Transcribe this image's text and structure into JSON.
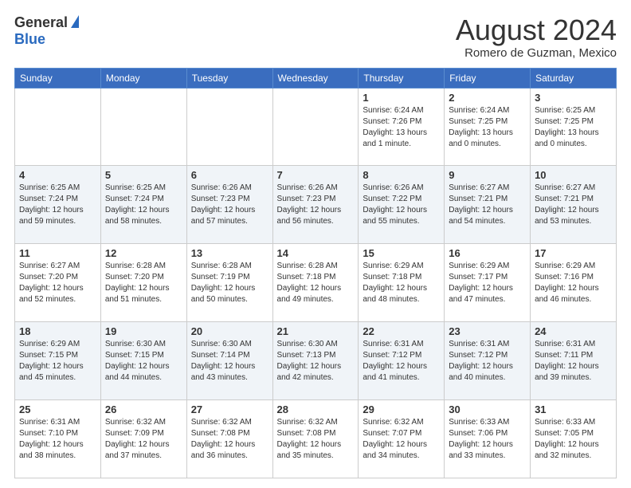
{
  "header": {
    "logo_general": "General",
    "logo_blue": "Blue",
    "month_title": "August 2024",
    "location": "Romero de Guzman, Mexico"
  },
  "days_of_week": [
    "Sunday",
    "Monday",
    "Tuesday",
    "Wednesday",
    "Thursday",
    "Friday",
    "Saturday"
  ],
  "weeks": [
    {
      "shade": false,
      "days": [
        {
          "num": "",
          "info": ""
        },
        {
          "num": "",
          "info": ""
        },
        {
          "num": "",
          "info": ""
        },
        {
          "num": "",
          "info": ""
        },
        {
          "num": "1",
          "info": "Sunrise: 6:24 AM\nSunset: 7:26 PM\nDaylight: 13 hours\nand 1 minute."
        },
        {
          "num": "2",
          "info": "Sunrise: 6:24 AM\nSunset: 7:25 PM\nDaylight: 13 hours\nand 0 minutes."
        },
        {
          "num": "3",
          "info": "Sunrise: 6:25 AM\nSunset: 7:25 PM\nDaylight: 13 hours\nand 0 minutes."
        }
      ]
    },
    {
      "shade": true,
      "days": [
        {
          "num": "4",
          "info": "Sunrise: 6:25 AM\nSunset: 7:24 PM\nDaylight: 12 hours\nand 59 minutes."
        },
        {
          "num": "5",
          "info": "Sunrise: 6:25 AM\nSunset: 7:24 PM\nDaylight: 12 hours\nand 58 minutes."
        },
        {
          "num": "6",
          "info": "Sunrise: 6:26 AM\nSunset: 7:23 PM\nDaylight: 12 hours\nand 57 minutes."
        },
        {
          "num": "7",
          "info": "Sunrise: 6:26 AM\nSunset: 7:23 PM\nDaylight: 12 hours\nand 56 minutes."
        },
        {
          "num": "8",
          "info": "Sunrise: 6:26 AM\nSunset: 7:22 PM\nDaylight: 12 hours\nand 55 minutes."
        },
        {
          "num": "9",
          "info": "Sunrise: 6:27 AM\nSunset: 7:21 PM\nDaylight: 12 hours\nand 54 minutes."
        },
        {
          "num": "10",
          "info": "Sunrise: 6:27 AM\nSunset: 7:21 PM\nDaylight: 12 hours\nand 53 minutes."
        }
      ]
    },
    {
      "shade": false,
      "days": [
        {
          "num": "11",
          "info": "Sunrise: 6:27 AM\nSunset: 7:20 PM\nDaylight: 12 hours\nand 52 minutes."
        },
        {
          "num": "12",
          "info": "Sunrise: 6:28 AM\nSunset: 7:20 PM\nDaylight: 12 hours\nand 51 minutes."
        },
        {
          "num": "13",
          "info": "Sunrise: 6:28 AM\nSunset: 7:19 PM\nDaylight: 12 hours\nand 50 minutes."
        },
        {
          "num": "14",
          "info": "Sunrise: 6:28 AM\nSunset: 7:18 PM\nDaylight: 12 hours\nand 49 minutes."
        },
        {
          "num": "15",
          "info": "Sunrise: 6:29 AM\nSunset: 7:18 PM\nDaylight: 12 hours\nand 48 minutes."
        },
        {
          "num": "16",
          "info": "Sunrise: 6:29 AM\nSunset: 7:17 PM\nDaylight: 12 hours\nand 47 minutes."
        },
        {
          "num": "17",
          "info": "Sunrise: 6:29 AM\nSunset: 7:16 PM\nDaylight: 12 hours\nand 46 minutes."
        }
      ]
    },
    {
      "shade": true,
      "days": [
        {
          "num": "18",
          "info": "Sunrise: 6:29 AM\nSunset: 7:15 PM\nDaylight: 12 hours\nand 45 minutes."
        },
        {
          "num": "19",
          "info": "Sunrise: 6:30 AM\nSunset: 7:15 PM\nDaylight: 12 hours\nand 44 minutes."
        },
        {
          "num": "20",
          "info": "Sunrise: 6:30 AM\nSunset: 7:14 PM\nDaylight: 12 hours\nand 43 minutes."
        },
        {
          "num": "21",
          "info": "Sunrise: 6:30 AM\nSunset: 7:13 PM\nDaylight: 12 hours\nand 42 minutes."
        },
        {
          "num": "22",
          "info": "Sunrise: 6:31 AM\nSunset: 7:12 PM\nDaylight: 12 hours\nand 41 minutes."
        },
        {
          "num": "23",
          "info": "Sunrise: 6:31 AM\nSunset: 7:12 PM\nDaylight: 12 hours\nand 40 minutes."
        },
        {
          "num": "24",
          "info": "Sunrise: 6:31 AM\nSunset: 7:11 PM\nDaylight: 12 hours\nand 39 minutes."
        }
      ]
    },
    {
      "shade": false,
      "days": [
        {
          "num": "25",
          "info": "Sunrise: 6:31 AM\nSunset: 7:10 PM\nDaylight: 12 hours\nand 38 minutes."
        },
        {
          "num": "26",
          "info": "Sunrise: 6:32 AM\nSunset: 7:09 PM\nDaylight: 12 hours\nand 37 minutes."
        },
        {
          "num": "27",
          "info": "Sunrise: 6:32 AM\nSunset: 7:08 PM\nDaylight: 12 hours\nand 36 minutes."
        },
        {
          "num": "28",
          "info": "Sunrise: 6:32 AM\nSunset: 7:08 PM\nDaylight: 12 hours\nand 35 minutes."
        },
        {
          "num": "29",
          "info": "Sunrise: 6:32 AM\nSunset: 7:07 PM\nDaylight: 12 hours\nand 34 minutes."
        },
        {
          "num": "30",
          "info": "Sunrise: 6:33 AM\nSunset: 7:06 PM\nDaylight: 12 hours\nand 33 minutes."
        },
        {
          "num": "31",
          "info": "Sunrise: 6:33 AM\nSunset: 7:05 PM\nDaylight: 12 hours\nand 32 minutes."
        }
      ]
    }
  ]
}
